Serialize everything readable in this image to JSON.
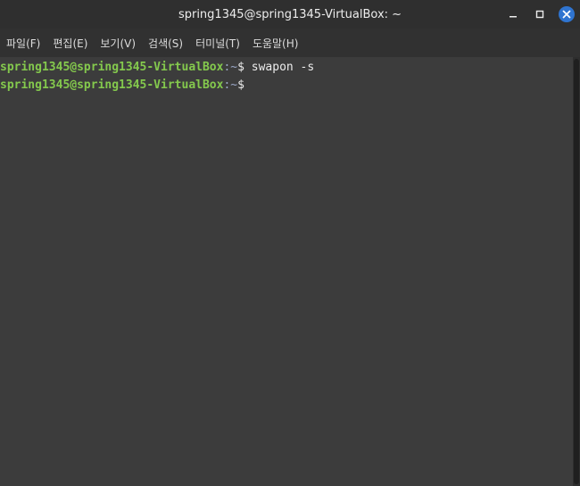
{
  "window": {
    "title": "spring1345@spring1345-VirtualBox: ~",
    "controls": [
      {
        "name": "minimize-icon"
      },
      {
        "name": "maximize-icon"
      },
      {
        "name": "close-icon"
      }
    ]
  },
  "menu": {
    "items": [
      {
        "label": "파일(F)"
      },
      {
        "label": "편집(E)"
      },
      {
        "label": "보기(V)"
      },
      {
        "label": "검색(S)"
      },
      {
        "label": "터미널(T)"
      },
      {
        "label": "도움말(H)"
      }
    ]
  },
  "terminal": {
    "lines": [
      {
        "user": "spring1345@spring1345-VirtualBox",
        "path": ":~",
        "symbol": "$",
        "command": " swapon -s"
      },
      {
        "user": "spring1345@spring1345-VirtualBox",
        "path": ":~",
        "symbol": "$",
        "command": ""
      }
    ]
  },
  "colors": {
    "prompt_user": "#84c94d",
    "prompt_path": "#9aa7c6",
    "terminal_bg": "#3c3c3c",
    "close_button": "#2f74d0"
  }
}
